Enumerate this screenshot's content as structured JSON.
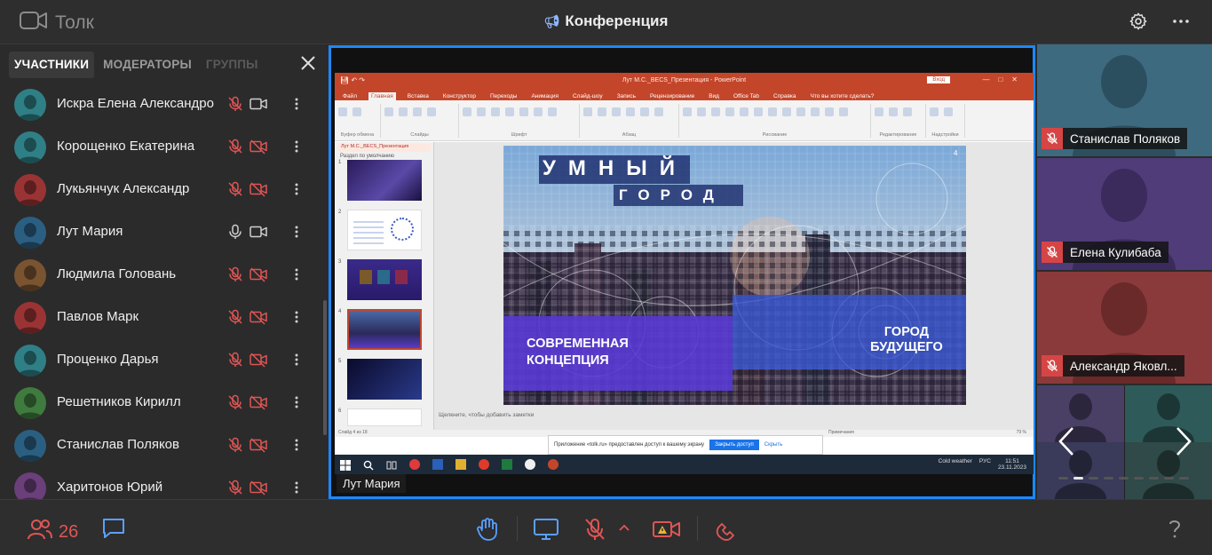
{
  "app": {
    "name": "Толк",
    "conference_title": "Конференция"
  },
  "sidebar": {
    "tabs": [
      {
        "label": "УЧАСТНИКИ",
        "state": "active"
      },
      {
        "label": "МОДЕРАТОРЫ",
        "state": "normal"
      },
      {
        "label": "ГРУППЫ",
        "state": "disabled"
      }
    ],
    "participants": [
      {
        "name": "Искра Елена Александро",
        "mic": "muted",
        "cam": "on",
        "avatar_color": "#2f7f86"
      },
      {
        "name": "Корощенко Екатерина",
        "mic": "muted",
        "cam": "off",
        "avatar_color": "#2f7f86"
      },
      {
        "name": "Лукьянчук Александр",
        "mic": "muted",
        "cam": "off",
        "avatar_color": "#9a3434"
      },
      {
        "name": "Лут Мария",
        "mic": "on",
        "cam": "on",
        "avatar_color": "#2b5f82"
      },
      {
        "name": "Людмила Головань",
        "mic": "muted",
        "cam": "off",
        "avatar_color": "#7a5330"
      },
      {
        "name": "Павлов Марк",
        "mic": "muted",
        "cam": "off",
        "avatar_color": "#9a3434"
      },
      {
        "name": "Проценко Дарья",
        "mic": "muted",
        "cam": "off",
        "avatar_color": "#2f7f86"
      },
      {
        "name": "Решетников Кирилл",
        "mic": "muted",
        "cam": "off",
        "avatar_color": "#3f7a3f"
      },
      {
        "name": "Станислав Поляков",
        "mic": "muted",
        "cam": "off",
        "avatar_color": "#2b5f82"
      },
      {
        "name": "Харитонов Юрий",
        "mic": "muted",
        "cam": "off",
        "avatar_color": "#6a3f7a"
      }
    ]
  },
  "stage": {
    "presenter_label": "Лут Мария",
    "screen": {
      "window_title": "Лут М.С._BECS_Презентация - PowerPoint",
      "login_button": "Вход",
      "menu": [
        "Файл",
        "Главная",
        "Вставка",
        "Конструктор",
        "Переходы",
        "Анимация",
        "Слайд-шоу",
        "Запись",
        "Рецензирование",
        "Вид",
        "Office Tab",
        "Справка",
        "Что вы хотите сделать?"
      ],
      "ribbon_groups": [
        "Буфер обмена",
        "Слайды",
        "Шрифт",
        "Абзац",
        "Рисование",
        "Редактирование",
        "Надстройки"
      ],
      "section_label": "Раздел по умолчанию",
      "tab_label": "Лут М.С._BECS_Презентация",
      "slide": {
        "word1": "УМНЫЙ",
        "word2": "ГОРОД",
        "left_caption": "СОВРЕМЕННАЯ КОНЦЕПЦИЯ",
        "right_caption": "ГОРОД БУДУЩЕГО",
        "number": "4"
      },
      "notes_placeholder": "Щелкните, чтобы добавить заметки",
      "notice_text": "Приложение «tolk.ru» предоставлен доступ к вашему экрану",
      "notice_button": "Закрыть доступ",
      "notice_hide": "Скрыть",
      "status_left": "Слайд 4 из 18",
      "zoom": "79 %",
      "weather": "Cold weather",
      "lang": "РУС",
      "time": "11:51",
      "date": "23.11.2023",
      "notes_button": "Примечания"
    }
  },
  "tiles": [
    {
      "name": "Станислав Поляков",
      "bg": "#3e6a80",
      "fg": "#2c4f60"
    },
    {
      "name": "Елена Кулибаба",
      "bg": "#4f3c78",
      "fg": "#3a2b5c"
    },
    {
      "name": "Александр Яковл...",
      "bg": "#8a3a3a",
      "fg": "#6a2a2a"
    }
  ],
  "grid_tile_colors": [
    "#4a4066",
    "#2f5a5a",
    "#3a3a5a",
    "#2f4a48"
  ],
  "pager": {
    "total": 9,
    "active": 1
  },
  "bottombar": {
    "participants_count": "26"
  },
  "colors": {
    "accent": "#1e88ff",
    "muted_red": "#e05555",
    "icon_blue": "#5aa0ff"
  }
}
